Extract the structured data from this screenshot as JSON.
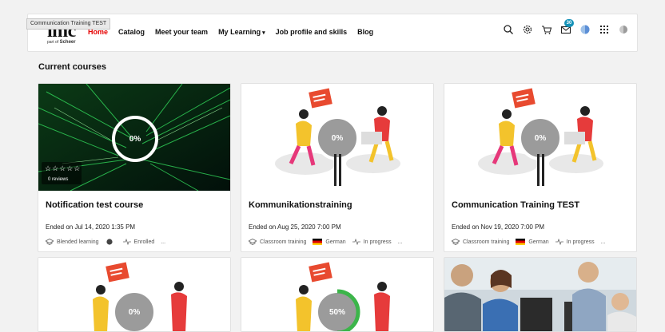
{
  "tooltip": "Communication Training TEST",
  "logo": {
    "main": "imc",
    "sub_prefix": "part of",
    "sub_brand": "Scheer"
  },
  "nav": {
    "home": "Home",
    "catalog": "Catalog",
    "team": "Meet your team",
    "learning": "My Learning",
    "learning_caret": "▾",
    "job": "Job profile and skills",
    "blog": "Blog"
  },
  "header_icons": [
    "search-icon",
    "gear-icon",
    "cart-icon",
    "mail-icon",
    "globe-icon",
    "apps-icon",
    "avatar"
  ],
  "mail_badge": "30",
  "section_title": "Current courses",
  "accent_color": "#e60000",
  "cards": [
    {
      "title": "Notification test course",
      "ended": "Ended on Jul 14, 2020 1:35 PM",
      "progress": "0%",
      "stars": "☆☆☆☆☆",
      "reviews": "0 reviews",
      "meta": [
        "Blended learning",
        "",
        "Enrolled",
        "..."
      ]
    },
    {
      "title": "Kommunikationstraining",
      "ended": "Ended on Aug 25, 2020 7:00 PM",
      "progress": "0%",
      "meta": [
        "Classroom training",
        "German",
        "In progress",
        "..."
      ]
    },
    {
      "title": "Communication Training TEST",
      "ended": "Ended on Nov 19, 2020 7:00 PM",
      "progress": "0%",
      "meta": [
        "Classroom training",
        "German",
        "In progress",
        "..."
      ]
    },
    {
      "progress": "0%",
      "progress_value": 0
    },
    {
      "progress": "50%",
      "progress_value": 0.5
    },
    {}
  ]
}
